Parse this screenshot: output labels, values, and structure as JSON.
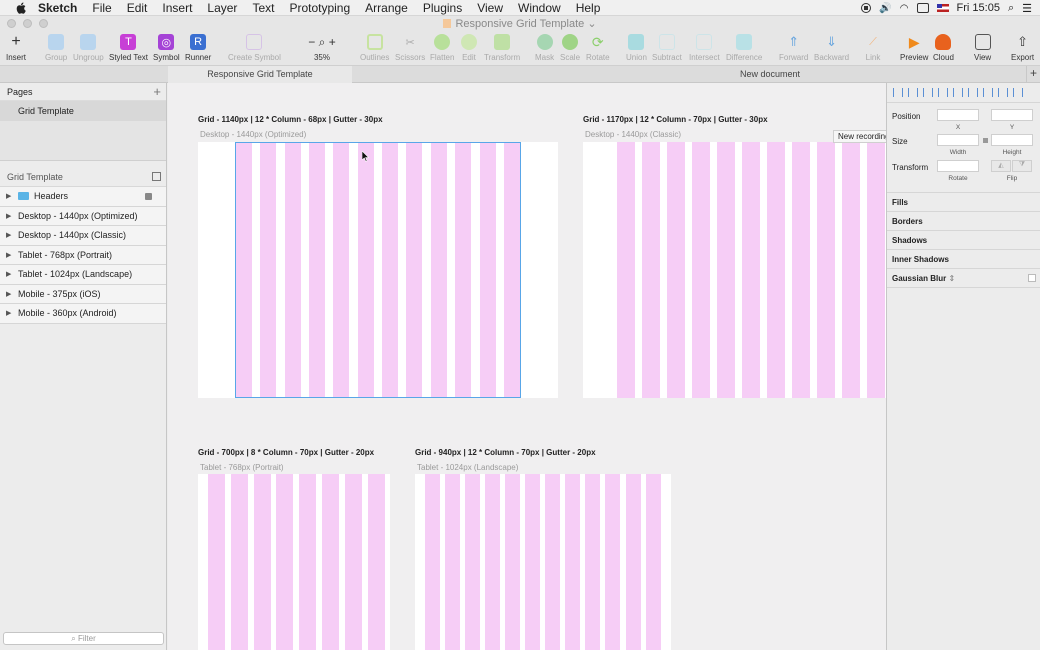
{
  "menubar": {
    "app": "Sketch",
    "items": [
      "File",
      "Edit",
      "Insert",
      "Layer",
      "Text",
      "Prototyping",
      "Arrange",
      "Plugins",
      "View",
      "Window",
      "Help"
    ],
    "clock": "Fri 15:05"
  },
  "window": {
    "title": "Responsive Grid Template"
  },
  "toolbar": {
    "insert": "Insert",
    "group": "Group",
    "ungroup": "Ungroup",
    "styled_text": "Styled Text",
    "symbol": "Symbol",
    "runner": "Runner",
    "create_symbol": "Create Symbol",
    "zoom": "35%",
    "outlines": "Outlines",
    "scissors": "Scissors",
    "flatten": "Flatten",
    "edit": "Edit",
    "transform": "Transform",
    "mask": "Mask",
    "scale": "Scale",
    "rotate": "Rotate",
    "union": "Union",
    "subtract": "Subtract",
    "intersect": "Intersect",
    "difference": "Difference",
    "forward": "Forward",
    "backward": "Backward",
    "link": "Link",
    "preview": "Preview",
    "cloud": "Cloud",
    "view": "View",
    "export": "Export"
  },
  "tabs": [
    "Responsive Grid Template",
    "New document"
  ],
  "pages_panel": {
    "title": "Pages",
    "items": [
      "Grid Template"
    ]
  },
  "layers_panel": {
    "title": "Grid Template",
    "items": [
      "Headers",
      "Desktop - 1440px (Optimized)",
      "Desktop - 1440px (Classic)",
      "Tablet - 768px (Portrait)",
      "Tablet - 1024px (Landscape)",
      "Mobile - 375px (iOS)",
      "Mobile - 360px (Android)"
    ],
    "filter_placeholder": "Filter"
  },
  "canvas": {
    "artboards": [
      {
        "label": "Grid - 1140px  |  12 * Column - 68px  |  Gutter - 30px",
        "name": "Desktop - 1440px (Optimized)",
        "columns": 12
      },
      {
        "label": "Grid - 1170px  |  12 * Column - 70px  |  Gutter - 30px",
        "name": "Desktop - 1440px (Classic)",
        "columns": 12
      },
      {
        "label": "Grid - 700px  |  8 * Column - 70px  |  Gutter - 20px",
        "name": "Tablet - 768px (Portrait)",
        "columns": 8
      },
      {
        "label": "Grid - 940px  |  12 * Column - 70px  |  Gutter - 20px",
        "name": "Tablet - 1024px (Landscape)",
        "columns": 12
      }
    ],
    "tooltip": "New recording",
    "column_color": "#f6cdf6",
    "selection_color": "#58a6e8"
  },
  "inspector": {
    "position": "Position",
    "x": "X",
    "y": "Y",
    "size": "Size",
    "width": "Width",
    "height": "Height",
    "transform": "Transform",
    "rotate": "Rotate",
    "flip": "Flip",
    "sections": [
      "Fills",
      "Borders",
      "Shadows",
      "Inner Shadows",
      "Gaussian Blur"
    ]
  }
}
